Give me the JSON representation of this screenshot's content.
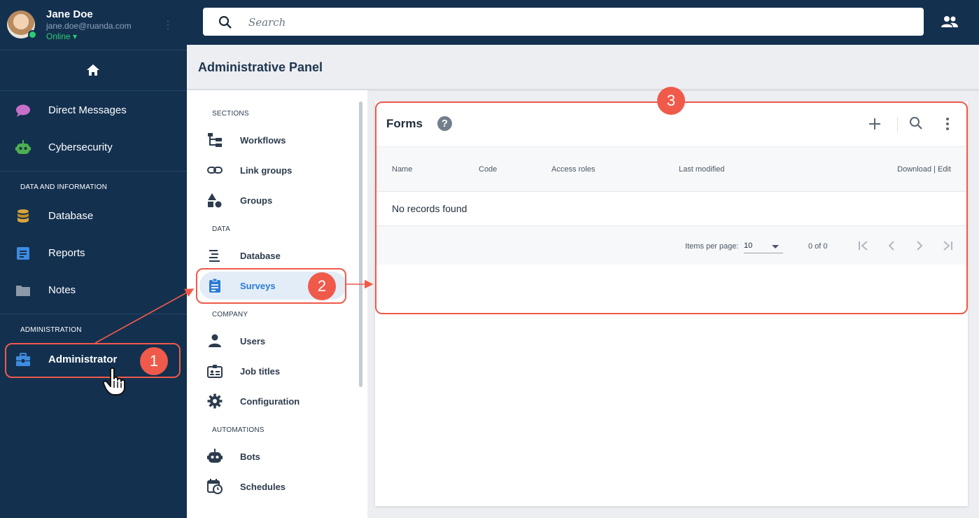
{
  "user": {
    "name": "Jane Doe",
    "email": "jane.doe@ruanda.com",
    "status": "Online ▾"
  },
  "sidebar": {
    "items": [
      {
        "label": "Direct Messages",
        "icon": "chat-bubble-icon",
        "color": "#c86fc9"
      },
      {
        "label": "Cybersecurity",
        "icon": "robot-icon",
        "color": "#4caf50"
      }
    ],
    "section_data": "DATA AND INFORMATION",
    "data_items": [
      {
        "label": "Database",
        "icon": "database-icon",
        "color": "#d9a53a"
      },
      {
        "label": "Reports",
        "icon": "report-icon",
        "color": "#3e8be0"
      },
      {
        "label": "Notes",
        "icon": "folder-icon",
        "color": "#8c99a8"
      }
    ],
    "section_admin": "ADMINISTRATION",
    "admin_items": [
      {
        "label": "Administrator",
        "icon": "toolbox-icon",
        "color": "#3e8be0"
      }
    ]
  },
  "search": {
    "placeholder": "Search"
  },
  "panel": {
    "title": "Administrative Panel"
  },
  "menu": {
    "sections": "SECTIONS",
    "workflows": "Workflows",
    "link_groups": "Link groups",
    "groups": "Groups",
    "data": "DATA",
    "database": "Database",
    "surveys": "Surveys",
    "company": "COMPANY",
    "users": "Users",
    "job_titles": "Job titles",
    "configuration": "Configuration",
    "automations": "AUTOMATIONS",
    "bots": "Bots",
    "schedules": "Schedules"
  },
  "forms": {
    "title": "Forms",
    "help": "?",
    "columns": [
      "Name",
      "Code",
      "Access roles",
      "Last modified",
      "Download | Edit"
    ],
    "empty": "No records found",
    "items_per_page_label": "Items per page:",
    "items_per_page": "10",
    "range": "0 of 0"
  },
  "annotations": [
    "1",
    "2",
    "3"
  ],
  "colors": {
    "sidebar_bg": "#13304f",
    "accent": "#2a7bd5",
    "annotation": "#ef5a4a",
    "selected_bg": "#e3edf8"
  }
}
